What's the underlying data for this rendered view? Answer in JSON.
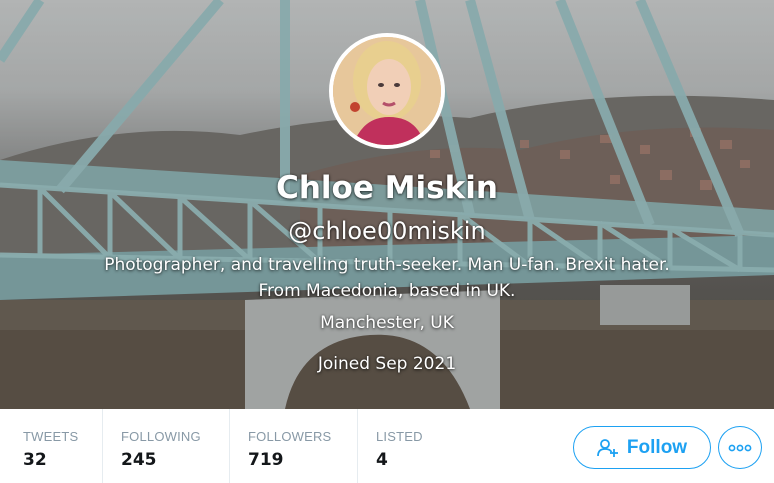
{
  "profile": {
    "display_name": "Chloe Miskin",
    "handle": "@chloe00miskin",
    "bio_line1": "Photographer, and travelling truth-seeker. Man U-fan. Brexit hater.",
    "bio_line2": "From Macedonia, based in UK.",
    "location": "Manchester, UK",
    "joined": "Joined Sep 2021"
  },
  "stats": [
    {
      "label": "TWEETS",
      "value": "32"
    },
    {
      "label": "FOLLOWING",
      "value": "245"
    },
    {
      "label": "FOLLOWERS",
      "value": "719"
    },
    {
      "label": "LISTED",
      "value": "4"
    }
  ],
  "actions": {
    "follow_label": "Follow",
    "follow_icon": "add-user-icon",
    "more_icon": "more-horizontal-icon"
  },
  "colors": {
    "accent": "#1da1f2",
    "stat_label": "#8899a6",
    "stat_value": "#14171a"
  }
}
